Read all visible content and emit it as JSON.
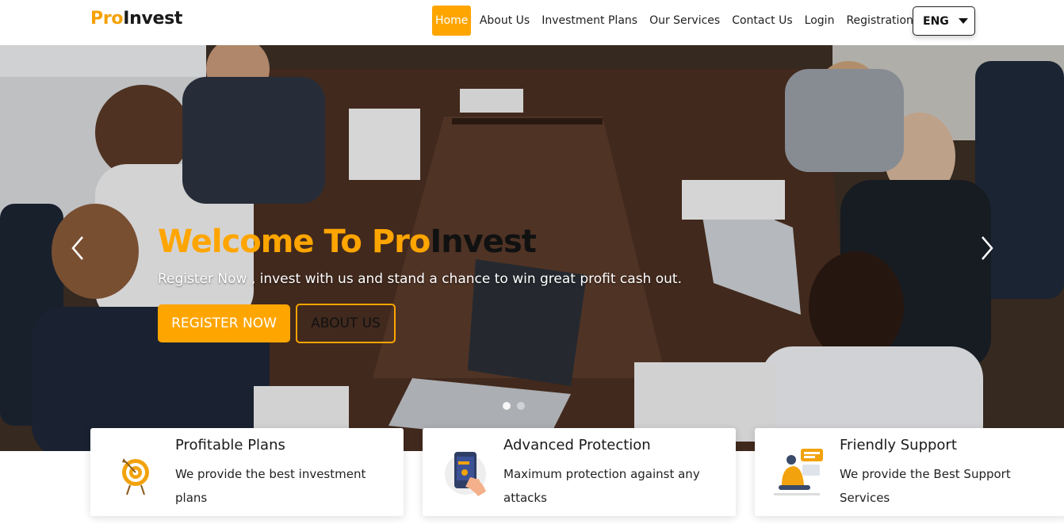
{
  "brand": {
    "prefix": "Pro",
    "suffix": "Invest"
  },
  "nav": {
    "items": [
      {
        "label": "Home",
        "active": true
      },
      {
        "label": "About Us"
      },
      {
        "label": "Investment Plans"
      },
      {
        "label": "Our Services"
      },
      {
        "label": "Contact Us"
      },
      {
        "label": "Login"
      },
      {
        "label": "Registration"
      }
    ],
    "language": "ENG"
  },
  "hero": {
    "title_part1": "Welcome To ",
    "title_highlight": "Pro",
    "title_part2": "Invest",
    "subtitle": "Register Now , invest with us and stand a chance to win great profit cash out.",
    "register_label": "REGISTER NOW",
    "about_label": "ABOUT US",
    "slides": 2,
    "active_slide": 1
  },
  "features": [
    {
      "title": "Profitable Plans",
      "text": "We provide the best investment plans",
      "icon": "target-icon"
    },
    {
      "title": "Advanced Protection",
      "text": "Maximum protection against any attacks",
      "icon": "secure-phone-icon"
    },
    {
      "title": "Friendly Support",
      "text": "We provide the Best Support Services",
      "icon": "support-person-icon"
    }
  ],
  "colors": {
    "accent": "#ffa500",
    "brand_accent": "#f5a100",
    "text": "#1a1a1a"
  }
}
